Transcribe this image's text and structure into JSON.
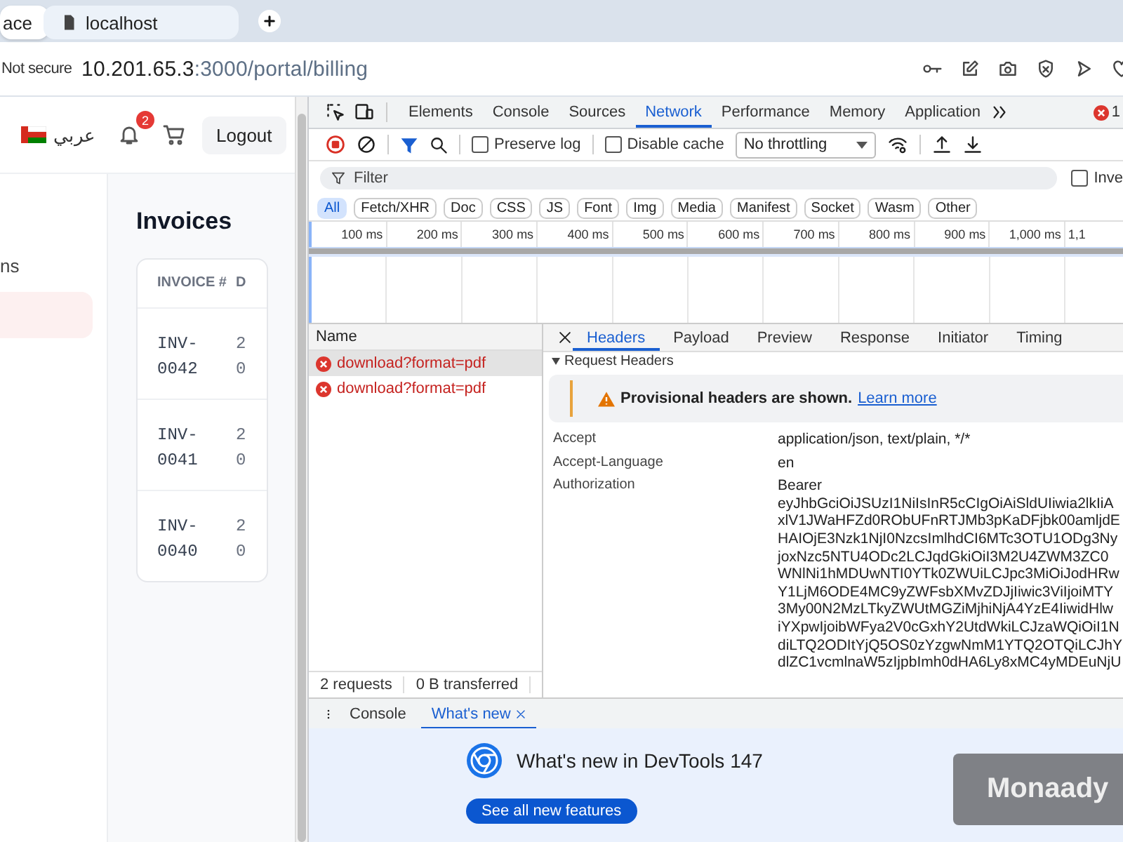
{
  "browser": {
    "tabs": [
      {
        "title": "ace",
        "selected": true
      },
      {
        "title": "localhost",
        "selected": false
      }
    ],
    "address": {
      "security": "Not secure",
      "host": "10.201.65.3",
      "path": ":3000/portal/billing"
    }
  },
  "page": {
    "header": {
      "language": "عربي",
      "notification_count": "2",
      "logout": "Logout"
    },
    "sidebar": {
      "items": [
        {
          "label": "ns",
          "selected": false
        },
        {
          "selected": true
        }
      ]
    },
    "invoices": {
      "title": "Invoices",
      "columns": [
        "INVOICE #",
        "D"
      ],
      "rows": [
        [
          "INV-0042",
          "2 0"
        ],
        [
          "INV-0041",
          "2 0"
        ],
        [
          "INV-0040",
          "2 0"
        ]
      ]
    }
  },
  "devtools": {
    "panel_tabs": [
      {
        "label": "Elements",
        "selected": false
      },
      {
        "label": "Console",
        "selected": false
      },
      {
        "label": "Sources",
        "selected": false
      },
      {
        "label": "Network",
        "selected": true
      },
      {
        "label": "Performance",
        "selected": false
      },
      {
        "label": "Memory",
        "selected": false
      },
      {
        "label": "Application",
        "selected": false
      }
    ],
    "error_count": "1",
    "toolbar": {
      "preserve_log": {
        "label": "Preserve log",
        "checked": false
      },
      "disable_cache": {
        "label": "Disable cache",
        "checked": false
      },
      "throttling": "No throttling"
    },
    "filter": {
      "placeholder": "Filter"
    },
    "invert": {
      "label": "Inve",
      "checked": false
    },
    "type_filters": [
      {
        "label": "All",
        "selected": true
      },
      {
        "label": "Fetch/XHR",
        "selected": false
      },
      {
        "label": "Doc",
        "selected": false
      },
      {
        "label": "CSS",
        "selected": false
      },
      {
        "label": "JS",
        "selected": false
      },
      {
        "label": "Font",
        "selected": false
      },
      {
        "label": "Img",
        "selected": false
      },
      {
        "label": "Media",
        "selected": false
      },
      {
        "label": "Manifest",
        "selected": false
      },
      {
        "label": "Socket",
        "selected": false
      },
      {
        "label": "Wasm",
        "selected": false
      },
      {
        "label": "Other",
        "selected": false
      }
    ],
    "timeline": {
      "ticks": [
        "100 ms",
        "200 ms",
        "300 ms",
        "400 ms",
        "500 ms",
        "600 ms",
        "700 ms",
        "800 ms",
        "900 ms",
        "1,000 ms",
        "1,1"
      ]
    },
    "requests": {
      "column": "Name",
      "rows": [
        {
          "name": "download?format=pdf",
          "failed": true,
          "selected": true
        },
        {
          "name": "download?format=pdf",
          "failed": true,
          "selected": false
        }
      ],
      "summary": [
        "2 requests",
        "0 B transferred"
      ]
    },
    "details": {
      "tabs": [
        {
          "label": "Headers",
          "selected": true
        },
        {
          "label": "Payload",
          "selected": false
        },
        {
          "label": "Preview",
          "selected": false
        },
        {
          "label": "Response",
          "selected": false
        },
        {
          "label": "Initiator",
          "selected": false
        },
        {
          "label": "Timing",
          "selected": false
        }
      ],
      "section": "Request Headers",
      "warning": {
        "text": "Provisional headers are shown.",
        "link": "Learn more"
      },
      "headers": [
        {
          "name": "Accept",
          "value": [
            "application/json, text/plain, */*"
          ]
        },
        {
          "name": "Accept-Language",
          "value": [
            "en"
          ]
        },
        {
          "name": "Authorization",
          "value": [
            "Bearer",
            "eyJhbGciOiJSUzI1NiIsInR5cCIgOiAiSldUIiwia2lkIiA",
            "xlV1JWaHFZd0RObUFnRTJMb3pKaDFjbk00amljdE",
            "HAIOjE3Nzk1NjI0NzcsImlhdCI6MTc3OTU1ODg3Ny",
            "joxNzc5NTU4ODc2LCJqdGkiOiI3M2U4ZWM3ZC0",
            "WNlNi1hMDUwNTI0YTk0ZWUiLCJpc3MiOiJodHRw",
            "Y1LjM6ODE4MC9yZWFsbXMvZDJjIiwic3ViIjoiMTY",
            "3My00N2MzLTkyZWUtMGZiMjhiNjA4YzE4IiwidHlw",
            "iYXpwIjoibWFya2V0cGxhY2UtdWkiLCJzaWQiOiI1N",
            "diLTQ2ODItYjQ5OS0zYzgwNmM1YTQ2OTQiLCJhY",
            "dlZC1vcmlnaW5zIjpbImh0dHA6Ly8xMC4yMDEuNjU"
          ]
        }
      ]
    },
    "drawer": {
      "tabs": [
        {
          "label": "Console",
          "selected": false,
          "closable": false
        },
        {
          "label": "What's new",
          "selected": true,
          "closable": true
        }
      ],
      "whats_new": {
        "title": "What's new in DevTools 147",
        "button": "See all new features",
        "card": "Monaady"
      }
    }
  }
}
